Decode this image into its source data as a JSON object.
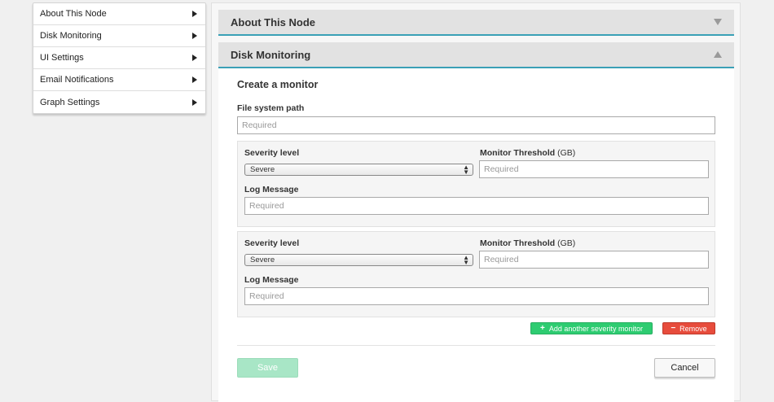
{
  "sidebar": {
    "items": [
      {
        "label": "About This Node"
      },
      {
        "label": "Disk Monitoring"
      },
      {
        "label": "UI Settings"
      },
      {
        "label": "Email Notifications"
      },
      {
        "label": "Graph Settings"
      }
    ]
  },
  "accordion": {
    "about_title": "About This Node",
    "disk_title": "Disk Monitoring"
  },
  "form": {
    "title": "Create a monitor",
    "path_label": "File system path",
    "path_placeholder": "Required",
    "monitors": [
      {
        "severity_label": "Severity level",
        "severity_value": "Severe",
        "threshold_label": "Monitor Threshold",
        "threshold_unit": "(GB)",
        "threshold_placeholder": "Required",
        "message_label": "Log Message",
        "message_placeholder": "Required"
      },
      {
        "severity_label": "Severity level",
        "severity_value": "Severe",
        "threshold_label": "Monitor Threshold",
        "threshold_unit": "(GB)",
        "threshold_placeholder": "Required",
        "message_label": "Log Message",
        "message_placeholder": "Required"
      }
    ],
    "add_label": "Add another severity monitor",
    "add_icon": "+",
    "remove_label": "Remove",
    "remove_icon": "−",
    "save_label": "Save",
    "cancel_label": "Cancel"
  },
  "colors": {
    "accent": "#3aa0b6",
    "add": "#2ecc71",
    "remove": "#e74c3c",
    "save_disabled": "#a8e6c6"
  }
}
